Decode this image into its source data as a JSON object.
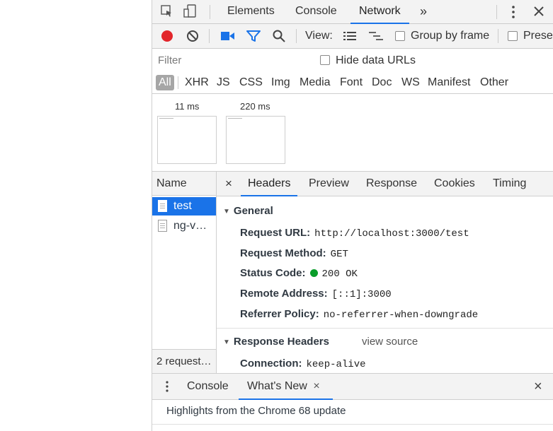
{
  "main_tabs": {
    "elements": "Elements",
    "console": "Console",
    "network": "Network",
    "more": "»"
  },
  "toolbar": {
    "view_label": "View:",
    "group_by_frame": "Group by frame",
    "preserve": "Prese"
  },
  "filter": {
    "placeholder": "Filter",
    "hide_data_urls": "Hide data URLs"
  },
  "type_filters": [
    "All",
    "XHR",
    "JS",
    "CSS",
    "Img",
    "Media",
    "Font",
    "Doc",
    "WS",
    "Manifest",
    "Other"
  ],
  "overview": {
    "times": [
      "11 ms",
      "220 ms"
    ]
  },
  "requests": {
    "header": "Name",
    "items": [
      "test",
      "ng-v…"
    ],
    "summary": "2 request…"
  },
  "detail_tabs": {
    "close": "×",
    "headers": "Headers",
    "preview": "Preview",
    "response": "Response",
    "cookies": "Cookies",
    "timing": "Timing"
  },
  "general": {
    "title": "General",
    "request_url_label": "Request URL:",
    "request_url_value": "http://localhost:3000/test",
    "request_method_label": "Request Method:",
    "request_method_value": "GET",
    "status_code_label": "Status Code:",
    "status_code_value": "200 OK",
    "remote_address_label": "Remote Address:",
    "remote_address_value": "[::1]:3000",
    "referrer_policy_label": "Referrer Policy:",
    "referrer_policy_value": "no-referrer-when-downgrade"
  },
  "response_headers": {
    "title": "Response Headers",
    "view_source": "view source",
    "connection_label": "Connection:",
    "connection_value": "keep-alive"
  },
  "drawer": {
    "console": "Console",
    "whats_new": "What's New",
    "tab_close": "×",
    "close": "×",
    "highlight": "Highlights from the Chrome 68 update"
  },
  "colors": {
    "accent": "#1a73e8",
    "record": "#e2262b",
    "toolbar_icon": "#1a73e8",
    "status_ok": "#0a9d2a"
  }
}
